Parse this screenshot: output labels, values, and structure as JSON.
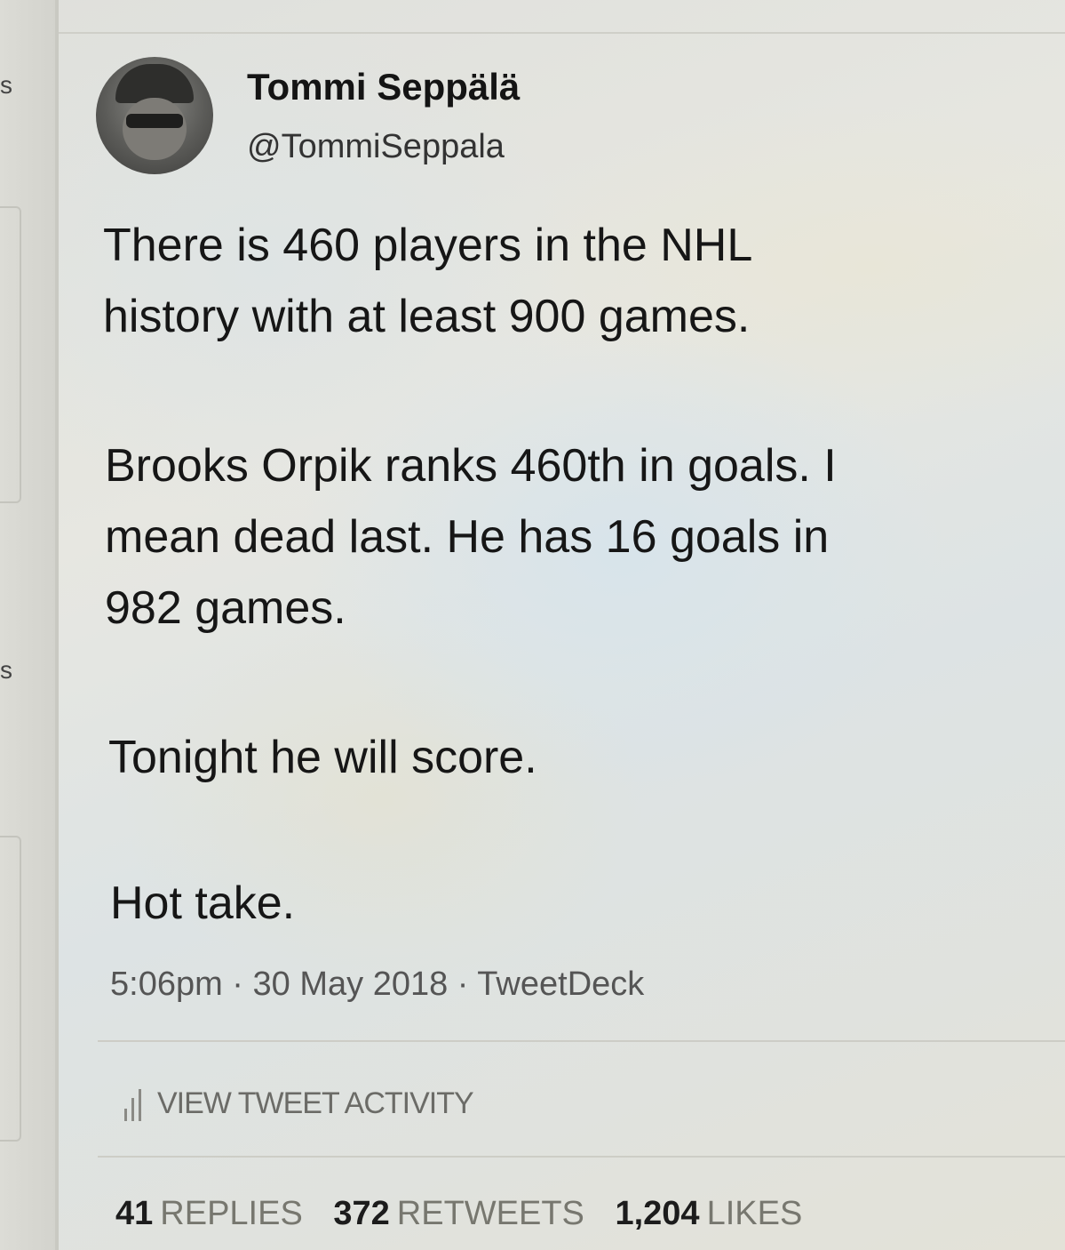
{
  "sidebar": {
    "fragment_top": "s",
    "fragment_mid": "s"
  },
  "tweet": {
    "display_name": "Tommi Seppälä",
    "handle": "@TommiSeppala",
    "paragraphs": [
      "There is 460 players in the NHL\nhistory with at least 900 games.",
      "Brooks Orpik ranks 460th in goals. I\nmean dead last. He has 16 goals in\n982 games.",
      "Tonight he will score.",
      "Hot take."
    ],
    "meta": "5:06pm · 30 May 2018 · TweetDeck",
    "view_activity": "VIEW TWEET ACTIVITY",
    "stats": {
      "replies_count": "41",
      "replies_label": "REPLIES",
      "retweets_count": "372",
      "retweets_label": "RETWEETS",
      "likes_count": "1,204",
      "likes_label": "LIKES"
    }
  }
}
